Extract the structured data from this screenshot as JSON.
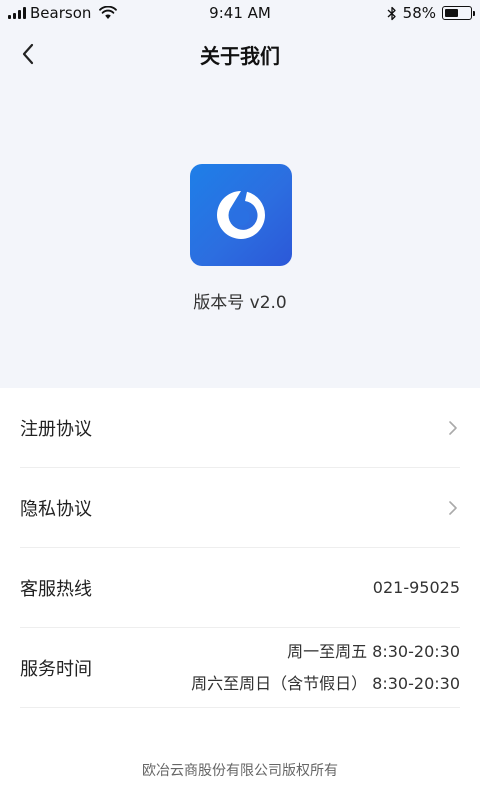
{
  "status_bar": {
    "carrier": "Bearson",
    "time": "9:41 AM",
    "battery_percent": "58%",
    "battery_level": 0.58
  },
  "nav": {
    "title": "关于我们",
    "back_icon": "chevron-left-icon"
  },
  "about": {
    "version_label": "版本号 v2.0",
    "logo_colors": [
      "#1e7fe8",
      "#2c58d8"
    ]
  },
  "list": {
    "register_agreement": "注册协议",
    "privacy_agreement": "隐私协议",
    "hotline_label": "客服热线",
    "hotline_value": "021-95025",
    "service_time_label": "服务时间",
    "service_time_weekday": "周一至周五  8:30-20:30",
    "service_time_weekend": "周六至周日（含节假日）  8:30-20:30"
  },
  "footer": {
    "copyright": "欧冶云商股份有限公司版权所有"
  }
}
